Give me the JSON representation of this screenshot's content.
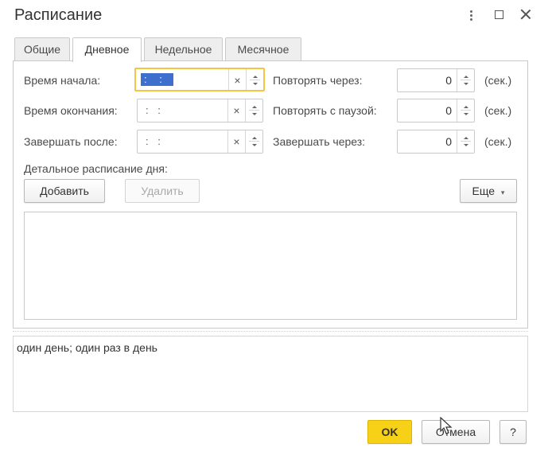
{
  "window": {
    "title": "Расписание"
  },
  "tabs": [
    {
      "label": "Общие",
      "active": false
    },
    {
      "label": "Дневное",
      "active": true
    },
    {
      "label": "Недельное",
      "active": false
    },
    {
      "label": "Месячное",
      "active": false
    }
  ],
  "daily": {
    "start_time": {
      "label": "Время начала:",
      "value": ": :"
    },
    "end_time": {
      "label": "Время окончания:",
      "value": ": :"
    },
    "finish_after": {
      "label": "Завершать после:",
      "value": ": :"
    },
    "repeat_every": {
      "label": "Повторять через:",
      "value": "0",
      "unit": "(сек.)"
    },
    "repeat_pause": {
      "label": "Повторять с паузой:",
      "value": "0",
      "unit": "(сек.)"
    },
    "finish_in": {
      "label": "Завершать через:",
      "value": "0",
      "unit": "(сек.)"
    },
    "detail_label": "Детальное расписание дня:",
    "add_button": "Добавить",
    "delete_button": "Удалить",
    "more_button": "Еще"
  },
  "icons": {
    "clear": "×",
    "more_arrow": "▾"
  },
  "summary_text": "один день; один раз в день",
  "footer": {
    "ok_button": "OK",
    "cancel_button": "Отмена",
    "help_button": "?"
  },
  "colors": {
    "accent": "#f7d117",
    "focus_border": "#f5c542",
    "selection": "#3f6fce"
  }
}
